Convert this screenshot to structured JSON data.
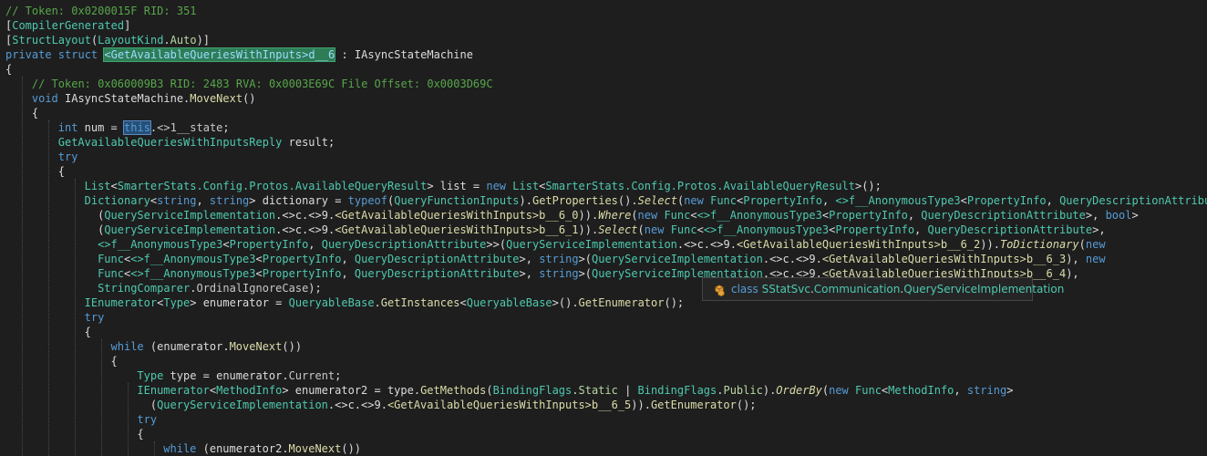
{
  "editor": {
    "colors": {
      "background": "#1e1e1e",
      "comment": "#57a64a",
      "keyword": "#569cd6",
      "type": "#4ec9b0",
      "method": "#dcdcaa",
      "plain": "#dcdcdc"
    },
    "lines": [
      {
        "indent": 0,
        "tokens": [
          [
            "comment",
            "// Token: 0x0200015F RID: 351"
          ]
        ]
      },
      {
        "indent": 0,
        "tokens": [
          [
            "plain",
            "["
          ],
          [
            "type",
            "CompilerGenerated"
          ],
          [
            "plain",
            "]"
          ]
        ]
      },
      {
        "indent": 0,
        "tokens": [
          [
            "plain",
            "["
          ],
          [
            "type",
            "StructLayout"
          ],
          [
            "plain",
            "("
          ],
          [
            "type",
            "LayoutKind"
          ],
          [
            "plain",
            "."
          ],
          [
            "enum",
            "Auto"
          ],
          [
            "plain",
            ")]"
          ]
        ]
      },
      {
        "indent": 0,
        "tokens": [
          [
            "keyword",
            "private struct "
          ],
          [
            "selected",
            "<GetAvailableQueriesWithInputs>d__6"
          ],
          [
            "plain",
            " : IAsyncStateMachine"
          ]
        ]
      },
      {
        "indent": 0,
        "tokens": [
          [
            "plain",
            "{"
          ]
        ]
      },
      {
        "indent": 1,
        "tokens": [
          [
            "comment",
            "// Token: 0x060009B3 RID: 2483 RVA: 0x0003E69C File Offset: 0x0003D69C"
          ]
        ]
      },
      {
        "indent": 1,
        "tokens": [
          [
            "keyword",
            "void "
          ],
          [
            "plain",
            "IAsyncStateMachine."
          ],
          [
            "method",
            "MoveNext"
          ],
          [
            "plain",
            "()"
          ]
        ]
      },
      {
        "indent": 1,
        "tokens": [
          [
            "plain",
            "{"
          ]
        ]
      },
      {
        "indent": 2,
        "tokens": [
          [
            "keyword",
            "int "
          ],
          [
            "plain",
            "num = "
          ],
          [
            "highlight",
            "this"
          ],
          [
            "plain",
            "."
          ],
          [
            "field",
            "<>1__state"
          ],
          [
            "plain",
            ";"
          ]
        ]
      },
      {
        "indent": 2,
        "tokens": [
          [
            "type",
            "GetAvailableQueriesWithInputsReply"
          ],
          [
            "plain",
            " result;"
          ]
        ]
      },
      {
        "indent": 2,
        "tokens": [
          [
            "keyword",
            "try"
          ]
        ]
      },
      {
        "indent": 2,
        "tokens": [
          [
            "plain",
            "{"
          ]
        ]
      },
      {
        "indent": 3,
        "tokens": [
          [
            "type",
            "List"
          ],
          [
            "plain",
            "<"
          ],
          [
            "type",
            "SmarterStats.Config.Protos.AvailableQueryResult"
          ],
          [
            "plain",
            "> list = "
          ],
          [
            "keyword",
            "new "
          ],
          [
            "type",
            "List"
          ],
          [
            "plain",
            "<"
          ],
          [
            "type",
            "SmarterStats.Config.Protos.AvailableQueryResult"
          ],
          [
            "plain",
            ">();"
          ]
        ]
      },
      {
        "indent": 3,
        "tokens": [
          [
            "type",
            "Dictionary"
          ],
          [
            "plain",
            "<"
          ],
          [
            "keyword",
            "string"
          ],
          [
            "plain",
            ", "
          ],
          [
            "keyword",
            "string"
          ],
          [
            "plain",
            "> dictionary = "
          ],
          [
            "keyword",
            "typeof"
          ],
          [
            "plain",
            "("
          ],
          [
            "type",
            "QueryFunctionInputs"
          ],
          [
            "plain",
            ")."
          ],
          [
            "method",
            "GetProperties"
          ],
          [
            "plain",
            "()."
          ],
          [
            "ext",
            "Select"
          ],
          [
            "plain",
            "("
          ],
          [
            "keyword",
            "new "
          ],
          [
            "type",
            "Func"
          ],
          [
            "plain",
            "<"
          ],
          [
            "type",
            "PropertyInfo"
          ],
          [
            "plain",
            ", "
          ],
          [
            "type",
            "<>f__AnonymousType3"
          ],
          [
            "plain",
            "<"
          ],
          [
            "type",
            "PropertyInfo"
          ],
          [
            "plain",
            ", "
          ],
          [
            "type",
            "QueryDescriptionAttribute"
          ],
          [
            "plain",
            ">>"
          ]
        ]
      },
      {
        "indent": 3.5,
        "tokens": [
          [
            "plain",
            "("
          ],
          [
            "type",
            "QueryServiceImplementation"
          ],
          [
            "plain",
            ".<>c.<>9."
          ],
          [
            "method",
            "<GetAvailableQueriesWithInputs>b__6_0"
          ],
          [
            "plain",
            "))."
          ],
          [
            "ext",
            "Where"
          ],
          [
            "plain",
            "("
          ],
          [
            "keyword",
            "new "
          ],
          [
            "type",
            "Func"
          ],
          [
            "plain",
            "<"
          ],
          [
            "type",
            "<>f__AnonymousType3"
          ],
          [
            "plain",
            "<"
          ],
          [
            "type",
            "PropertyInfo"
          ],
          [
            "plain",
            ", "
          ],
          [
            "type",
            "QueryDescriptionAttribute"
          ],
          [
            "plain",
            ">, "
          ],
          [
            "keyword",
            "bool"
          ],
          [
            "plain",
            ">"
          ]
        ]
      },
      {
        "indent": 3.5,
        "tokens": [
          [
            "plain",
            "("
          ],
          [
            "type",
            "QueryServiceImplementation"
          ],
          [
            "plain",
            ".<>c.<>9."
          ],
          [
            "method",
            "<GetAvailableQueriesWithInputs>b__6_1"
          ],
          [
            "plain",
            "))."
          ],
          [
            "ext",
            "Select"
          ],
          [
            "plain",
            "("
          ],
          [
            "keyword",
            "new "
          ],
          [
            "type",
            "Func"
          ],
          [
            "plain",
            "<"
          ],
          [
            "type",
            "<>f__AnonymousType3"
          ],
          [
            "plain",
            "<"
          ],
          [
            "type",
            "PropertyInfo"
          ],
          [
            "plain",
            ", "
          ],
          [
            "type",
            "QueryDescriptionAttribute"
          ],
          [
            "plain",
            ">,"
          ]
        ]
      },
      {
        "indent": 3.5,
        "tokens": [
          [
            "type",
            "<>f__AnonymousType3"
          ],
          [
            "plain",
            "<"
          ],
          [
            "type",
            "PropertyInfo"
          ],
          [
            "plain",
            ", "
          ],
          [
            "type",
            "QueryDescriptionAttribute"
          ],
          [
            "plain",
            ">>("
          ],
          [
            "type",
            "QueryServiceImplementation"
          ],
          [
            "plain",
            ".<>c.<>9."
          ],
          [
            "method",
            "<GetAvailableQueriesWithInputs>b__6_2"
          ],
          [
            "plain",
            "))."
          ],
          [
            "ext",
            "ToDictionary"
          ],
          [
            "plain",
            "("
          ],
          [
            "keyword",
            "new"
          ]
        ]
      },
      {
        "indent": 3.5,
        "tokens": [
          [
            "type",
            "Func"
          ],
          [
            "plain",
            "<"
          ],
          [
            "type",
            "<>f__AnonymousType3"
          ],
          [
            "plain",
            "<"
          ],
          [
            "type",
            "PropertyInfo"
          ],
          [
            "plain",
            ", "
          ],
          [
            "type",
            "QueryDescriptionAttribute"
          ],
          [
            "plain",
            ">, "
          ],
          [
            "keyword",
            "string"
          ],
          [
            "plain",
            ">("
          ],
          [
            "type",
            "QueryServiceImplementation"
          ],
          [
            "plain",
            ".<>c.<>9."
          ],
          [
            "method",
            "<GetAvailableQueriesWithInputs>b__6_3"
          ],
          [
            "plain",
            "), "
          ],
          [
            "keyword",
            "new"
          ]
        ]
      },
      {
        "indent": 3.5,
        "tokens": [
          [
            "type",
            "Func"
          ],
          [
            "plain",
            "<"
          ],
          [
            "type",
            "<>f__AnonymousType3"
          ],
          [
            "plain",
            "<"
          ],
          [
            "type",
            "PropertyInfo"
          ],
          [
            "plain",
            ", "
          ],
          [
            "type",
            "QueryDescriptionAttribute"
          ],
          [
            "plain",
            ">, "
          ],
          [
            "keyword",
            "string"
          ],
          [
            "plain",
            ">("
          ],
          [
            "type",
            "QueryServiceImplementation"
          ],
          [
            "plain",
            ".<>c.<>9."
          ],
          [
            "method",
            "<GetAvailableQueriesWithInputs>b__6_4"
          ],
          [
            "plain",
            "),"
          ]
        ]
      },
      {
        "indent": 3.5,
        "tokens": [
          [
            "type",
            "StringComparer"
          ],
          [
            "plain",
            "."
          ],
          [
            "field",
            "OrdinalIgnoreCase"
          ],
          [
            "plain",
            ");"
          ]
        ]
      },
      {
        "indent": 3,
        "tokens": [
          [
            "type",
            "IEnumerator"
          ],
          [
            "plain",
            "<"
          ],
          [
            "type",
            "Type"
          ],
          [
            "plain",
            "> enumerator = "
          ],
          [
            "type",
            "QueryableBase"
          ],
          [
            "plain",
            "."
          ],
          [
            "method",
            "GetInstances"
          ],
          [
            "plain",
            "<"
          ],
          [
            "type",
            "QueryableBase"
          ],
          [
            "plain",
            ">()."
          ],
          [
            "method",
            "GetEnumerator"
          ],
          [
            "plain",
            "();"
          ]
        ]
      },
      {
        "indent": 3,
        "tokens": [
          [
            "keyword",
            "try"
          ]
        ]
      },
      {
        "indent": 3,
        "tokens": [
          [
            "plain",
            "{"
          ]
        ]
      },
      {
        "indent": 4,
        "tokens": [
          [
            "keyword",
            "while "
          ],
          [
            "plain",
            "(enumerator."
          ],
          [
            "method",
            "MoveNext"
          ],
          [
            "plain",
            "())"
          ]
        ]
      },
      {
        "indent": 4,
        "tokens": [
          [
            "plain",
            "{"
          ]
        ]
      },
      {
        "indent": 5,
        "tokens": [
          [
            "type",
            "Type"
          ],
          [
            "plain",
            " type = enumerator."
          ],
          [
            "field",
            "Current"
          ],
          [
            "plain",
            ";"
          ]
        ]
      },
      {
        "indent": 5,
        "tokens": [
          [
            "type",
            "IEnumerator"
          ],
          [
            "plain",
            "<"
          ],
          [
            "type",
            "MethodInfo"
          ],
          [
            "plain",
            "> enumerator2 = type."
          ],
          [
            "method",
            "GetMethods"
          ],
          [
            "plain",
            "("
          ],
          [
            "type",
            "BindingFlags"
          ],
          [
            "plain",
            "."
          ],
          [
            "enum",
            "Static"
          ],
          [
            "plain",
            " | "
          ],
          [
            "type",
            "BindingFlags"
          ],
          [
            "plain",
            "."
          ],
          [
            "enum",
            "Public"
          ],
          [
            "plain",
            ")."
          ],
          [
            "ext",
            "OrderBy"
          ],
          [
            "plain",
            "("
          ],
          [
            "keyword",
            "new "
          ],
          [
            "type",
            "Func"
          ],
          [
            "plain",
            "<"
          ],
          [
            "type",
            "MethodInfo"
          ],
          [
            "plain",
            ", "
          ],
          [
            "keyword",
            "string"
          ],
          [
            "plain",
            ">"
          ]
        ]
      },
      {
        "indent": 5.5,
        "tokens": [
          [
            "plain",
            "("
          ],
          [
            "type",
            "QueryServiceImplementation"
          ],
          [
            "plain",
            ".<>c.<>9."
          ],
          [
            "method",
            "<GetAvailableQueriesWithInputs>b__6_5"
          ],
          [
            "plain",
            "))."
          ],
          [
            "method",
            "GetEnumerator"
          ],
          [
            "plain",
            "();"
          ]
        ]
      },
      {
        "indent": 5,
        "tokens": [
          [
            "keyword",
            "try"
          ]
        ]
      },
      {
        "indent": 5,
        "tokens": [
          [
            "plain",
            "{"
          ]
        ]
      },
      {
        "indent": 6,
        "tokens": [
          [
            "keyword",
            "while "
          ],
          [
            "plain",
            "(enumerator2."
          ],
          [
            "method",
            "MoveNext"
          ],
          [
            "plain",
            "())"
          ]
        ]
      }
    ]
  },
  "tooltip": {
    "icon": "class-icon",
    "kind": "class",
    "namespace_1": "SStatSvc",
    "namespace_2": "Communication",
    "name": "QueryServiceImplementation"
  }
}
